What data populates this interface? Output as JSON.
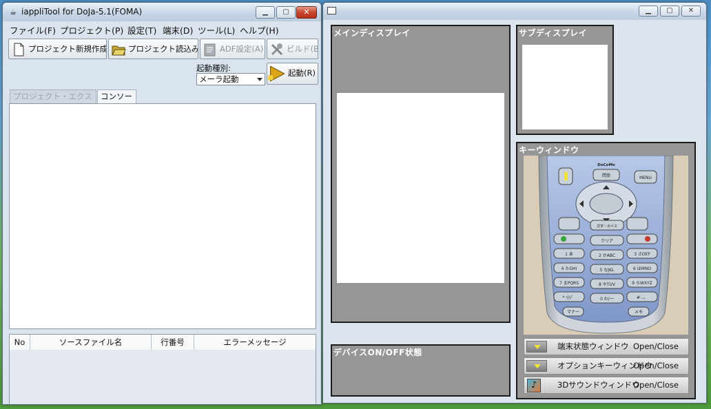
{
  "left_window": {
    "title": "iappliTool for DoJa-5.1(FOMA)",
    "menus": [
      "ファイル(F)",
      "プロジェクト(P)",
      "設定(T)",
      "端末(D)",
      "ツール(L)",
      "ヘルプ(H)"
    ],
    "toolbar": {
      "new_project": "プロジェクト新規作成(N)",
      "open_project": "プロジェクト読込み(O)",
      "adf_settings": "ADF設定(A)",
      "build": "ビルド(B)"
    },
    "launch_type_label": "起動種別:",
    "launch_type_value": "メーラ起動",
    "launch_button": "起動(R)",
    "tabs": [
      "プロジェクト・エクスプローラ",
      "コンソール"
    ],
    "error_table": {
      "columns": [
        "No",
        "ソースファイル名",
        "行番号",
        "エラーメッセージ"
      ],
      "rows": []
    }
  },
  "right_window": {
    "main_display_title": "メインディスプレイ",
    "sub_display_title": "サブディスプレイ",
    "key_window_title": "キーウィンドウ",
    "device_state_title": "デバイスON/OFF状態",
    "phone": {
      "brand": "DoCoMo",
      "keys": {
        "mail_center": "問受",
        "menu": "MENU",
        "voice": "文字・ボイス",
        "clear": "クリア",
        "k1": "1 あ",
        "k2": "2 かABC",
        "k3": "3 さDEF",
        "k4": "4 たGHI",
        "k5": "5 なJKL",
        "k6": "6 はMNO",
        "k7": "7 まPQRS",
        "k8": "8 やTUV",
        "k9": "9 らWXYZ",
        "kstar": "* 小/゛",
        "k0": "0 わ/ー",
        "khash": "# 、。",
        "manner": "マナー",
        "memo": "メモ"
      }
    },
    "controls": [
      {
        "label": "端末状態ウィンドウ",
        "action": "Open/Close",
        "icon": "toggle-arrow-icon"
      },
      {
        "label": "オプションキーウィンドウ",
        "action": "Open/Close",
        "icon": "toggle-arrow-icon"
      },
      {
        "label": "3Dサウンドウィンドウ",
        "action": "Open/Close",
        "icon": "music-note-icon"
      }
    ]
  }
}
